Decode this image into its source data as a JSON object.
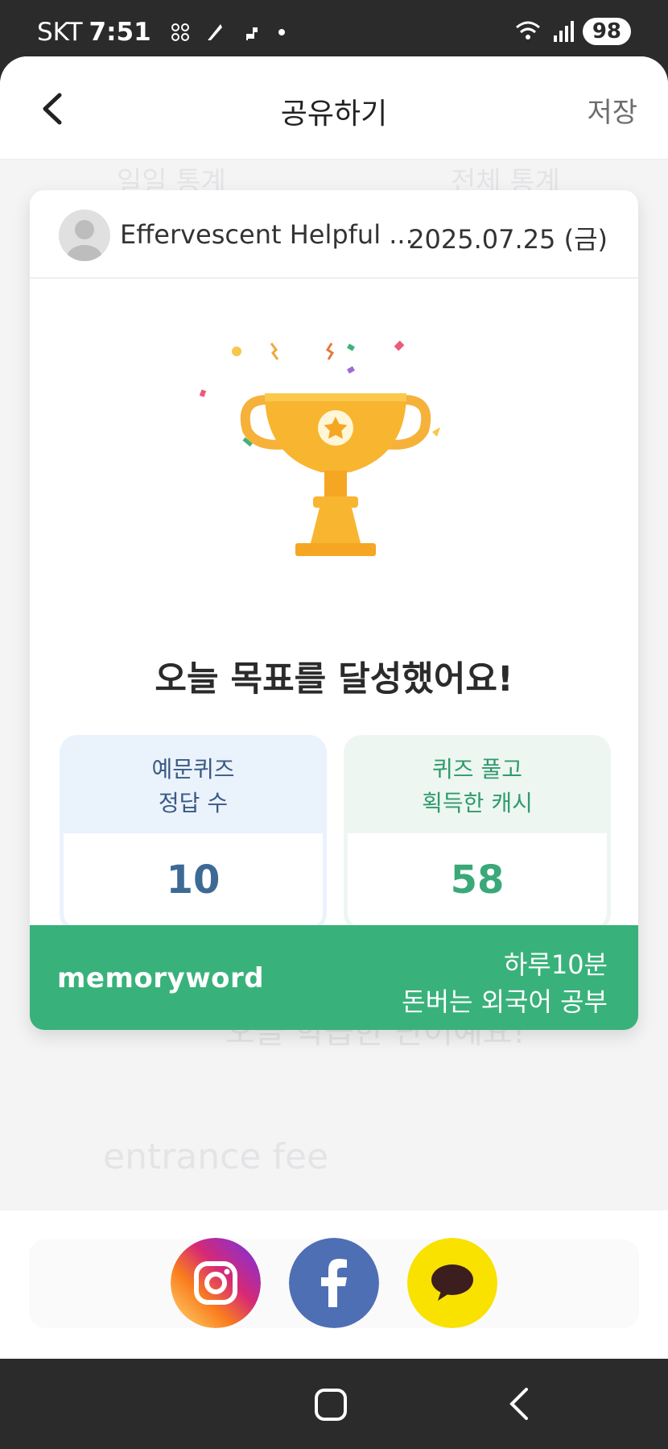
{
  "status_bar": {
    "carrier": "SKT",
    "time": "7:51",
    "battery": "98"
  },
  "header": {
    "title": "공유하기",
    "save_label": "저장"
  },
  "background_ghost": {
    "tab_left": "일일 통계",
    "tab_right": "전체 통계",
    "date": "2025.07.25 (금)",
    "goal": "오늘 목표를 달성했어요!",
    "learned": "오늘 학습한 단어예요!",
    "word": "entrance fee"
  },
  "card": {
    "user_name": "Effervescent Helpful ...",
    "date": "2025.07.25 (금)",
    "goal_text": "오늘 목표를 달성했어요!",
    "stats": [
      {
        "line1": "예문퀴즈",
        "line2": "정답 수",
        "value": "10"
      },
      {
        "line1": "퀴즈 풀고",
        "line2": "획득한 캐시",
        "value": "58"
      }
    ],
    "brand": "memoryword",
    "tagline_1": "하루10분",
    "tagline_2": "돈버는 외국어 공부"
  },
  "share": {
    "instagram_color": "#d6306b",
    "facebook_color": "#4f6fb5",
    "kakao_color": "#f9e100"
  },
  "colors": {
    "accent_green": "#38b27a",
    "stat_blue": "#3d6a95"
  }
}
